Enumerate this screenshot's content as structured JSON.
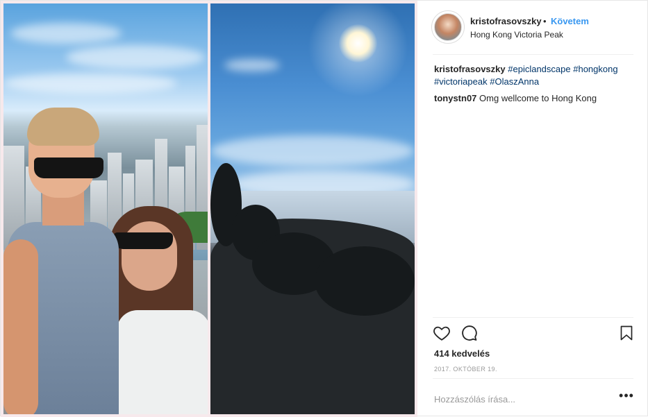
{
  "post": {
    "username": "kristofrasovszky",
    "separator": "•",
    "follow_label": "Követem",
    "location": "Hong Kong Victoria Peak",
    "caption": {
      "author": "kristofrasovszky",
      "hashtags": [
        "#epiclandscape",
        "#hongkong",
        "#victoriapeak",
        "#OlaszAnna"
      ]
    },
    "comments": [
      {
        "author": "tonystn07",
        "text": "Omg wellcome to Hong Kong"
      }
    ],
    "likes_text": "414 kedvelés",
    "date": "2017. október 19.",
    "comment_placeholder": "Hozzászólás írása...",
    "more_label": "•••"
  },
  "icons": {
    "like": "heart-icon",
    "comment": "comment-icon",
    "save": "bookmark-icon",
    "more": "more-options-icon"
  },
  "colors": {
    "follow": "#3897f0",
    "hashtag": "#003569",
    "muted": "#999999"
  }
}
